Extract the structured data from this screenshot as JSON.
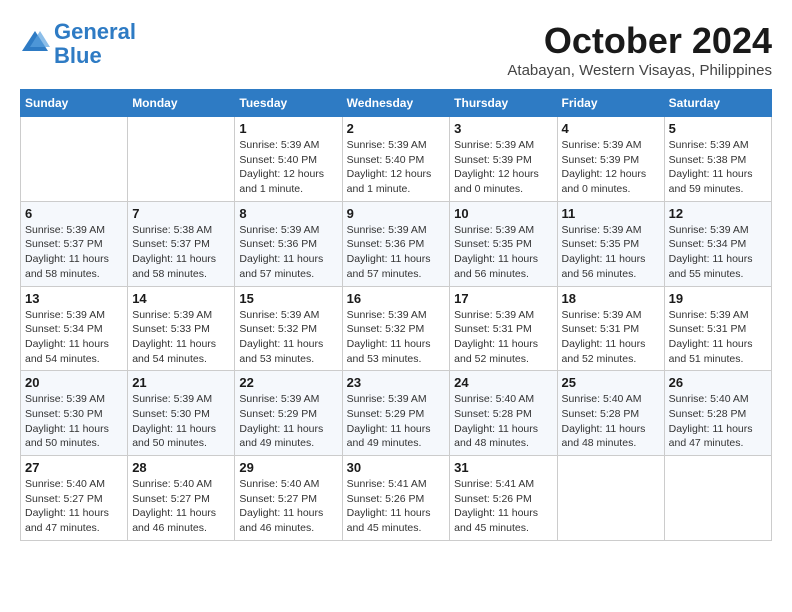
{
  "header": {
    "logo_line1": "General",
    "logo_line2": "Blue",
    "month_title": "October 2024",
    "subtitle": "Atabayan, Western Visayas, Philippines"
  },
  "weekdays": [
    "Sunday",
    "Monday",
    "Tuesday",
    "Wednesday",
    "Thursday",
    "Friday",
    "Saturday"
  ],
  "weeks": [
    [
      {
        "day": "",
        "text": ""
      },
      {
        "day": "",
        "text": ""
      },
      {
        "day": "1",
        "text": "Sunrise: 5:39 AM\nSunset: 5:40 PM\nDaylight: 12 hours\nand 1 minute."
      },
      {
        "day": "2",
        "text": "Sunrise: 5:39 AM\nSunset: 5:40 PM\nDaylight: 12 hours\nand 1 minute."
      },
      {
        "day": "3",
        "text": "Sunrise: 5:39 AM\nSunset: 5:39 PM\nDaylight: 12 hours\nand 0 minutes."
      },
      {
        "day": "4",
        "text": "Sunrise: 5:39 AM\nSunset: 5:39 PM\nDaylight: 12 hours\nand 0 minutes."
      },
      {
        "day": "5",
        "text": "Sunrise: 5:39 AM\nSunset: 5:38 PM\nDaylight: 11 hours\nand 59 minutes."
      }
    ],
    [
      {
        "day": "6",
        "text": "Sunrise: 5:39 AM\nSunset: 5:37 PM\nDaylight: 11 hours\nand 58 minutes."
      },
      {
        "day": "7",
        "text": "Sunrise: 5:38 AM\nSunset: 5:37 PM\nDaylight: 11 hours\nand 58 minutes."
      },
      {
        "day": "8",
        "text": "Sunrise: 5:39 AM\nSunset: 5:36 PM\nDaylight: 11 hours\nand 57 minutes."
      },
      {
        "day": "9",
        "text": "Sunrise: 5:39 AM\nSunset: 5:36 PM\nDaylight: 11 hours\nand 57 minutes."
      },
      {
        "day": "10",
        "text": "Sunrise: 5:39 AM\nSunset: 5:35 PM\nDaylight: 11 hours\nand 56 minutes."
      },
      {
        "day": "11",
        "text": "Sunrise: 5:39 AM\nSunset: 5:35 PM\nDaylight: 11 hours\nand 56 minutes."
      },
      {
        "day": "12",
        "text": "Sunrise: 5:39 AM\nSunset: 5:34 PM\nDaylight: 11 hours\nand 55 minutes."
      }
    ],
    [
      {
        "day": "13",
        "text": "Sunrise: 5:39 AM\nSunset: 5:34 PM\nDaylight: 11 hours\nand 54 minutes."
      },
      {
        "day": "14",
        "text": "Sunrise: 5:39 AM\nSunset: 5:33 PM\nDaylight: 11 hours\nand 54 minutes."
      },
      {
        "day": "15",
        "text": "Sunrise: 5:39 AM\nSunset: 5:32 PM\nDaylight: 11 hours\nand 53 minutes."
      },
      {
        "day": "16",
        "text": "Sunrise: 5:39 AM\nSunset: 5:32 PM\nDaylight: 11 hours\nand 53 minutes."
      },
      {
        "day": "17",
        "text": "Sunrise: 5:39 AM\nSunset: 5:31 PM\nDaylight: 11 hours\nand 52 minutes."
      },
      {
        "day": "18",
        "text": "Sunrise: 5:39 AM\nSunset: 5:31 PM\nDaylight: 11 hours\nand 52 minutes."
      },
      {
        "day": "19",
        "text": "Sunrise: 5:39 AM\nSunset: 5:31 PM\nDaylight: 11 hours\nand 51 minutes."
      }
    ],
    [
      {
        "day": "20",
        "text": "Sunrise: 5:39 AM\nSunset: 5:30 PM\nDaylight: 11 hours\nand 50 minutes."
      },
      {
        "day": "21",
        "text": "Sunrise: 5:39 AM\nSunset: 5:30 PM\nDaylight: 11 hours\nand 50 minutes."
      },
      {
        "day": "22",
        "text": "Sunrise: 5:39 AM\nSunset: 5:29 PM\nDaylight: 11 hours\nand 49 minutes."
      },
      {
        "day": "23",
        "text": "Sunrise: 5:39 AM\nSunset: 5:29 PM\nDaylight: 11 hours\nand 49 minutes."
      },
      {
        "day": "24",
        "text": "Sunrise: 5:40 AM\nSunset: 5:28 PM\nDaylight: 11 hours\nand 48 minutes."
      },
      {
        "day": "25",
        "text": "Sunrise: 5:40 AM\nSunset: 5:28 PM\nDaylight: 11 hours\nand 48 minutes."
      },
      {
        "day": "26",
        "text": "Sunrise: 5:40 AM\nSunset: 5:28 PM\nDaylight: 11 hours\nand 47 minutes."
      }
    ],
    [
      {
        "day": "27",
        "text": "Sunrise: 5:40 AM\nSunset: 5:27 PM\nDaylight: 11 hours\nand 47 minutes."
      },
      {
        "day": "28",
        "text": "Sunrise: 5:40 AM\nSunset: 5:27 PM\nDaylight: 11 hours\nand 46 minutes."
      },
      {
        "day": "29",
        "text": "Sunrise: 5:40 AM\nSunset: 5:27 PM\nDaylight: 11 hours\nand 46 minutes."
      },
      {
        "day": "30",
        "text": "Sunrise: 5:41 AM\nSunset: 5:26 PM\nDaylight: 11 hours\nand 45 minutes."
      },
      {
        "day": "31",
        "text": "Sunrise: 5:41 AM\nSunset: 5:26 PM\nDaylight: 11 hours\nand 45 minutes."
      },
      {
        "day": "",
        "text": ""
      },
      {
        "day": "",
        "text": ""
      }
    ]
  ]
}
